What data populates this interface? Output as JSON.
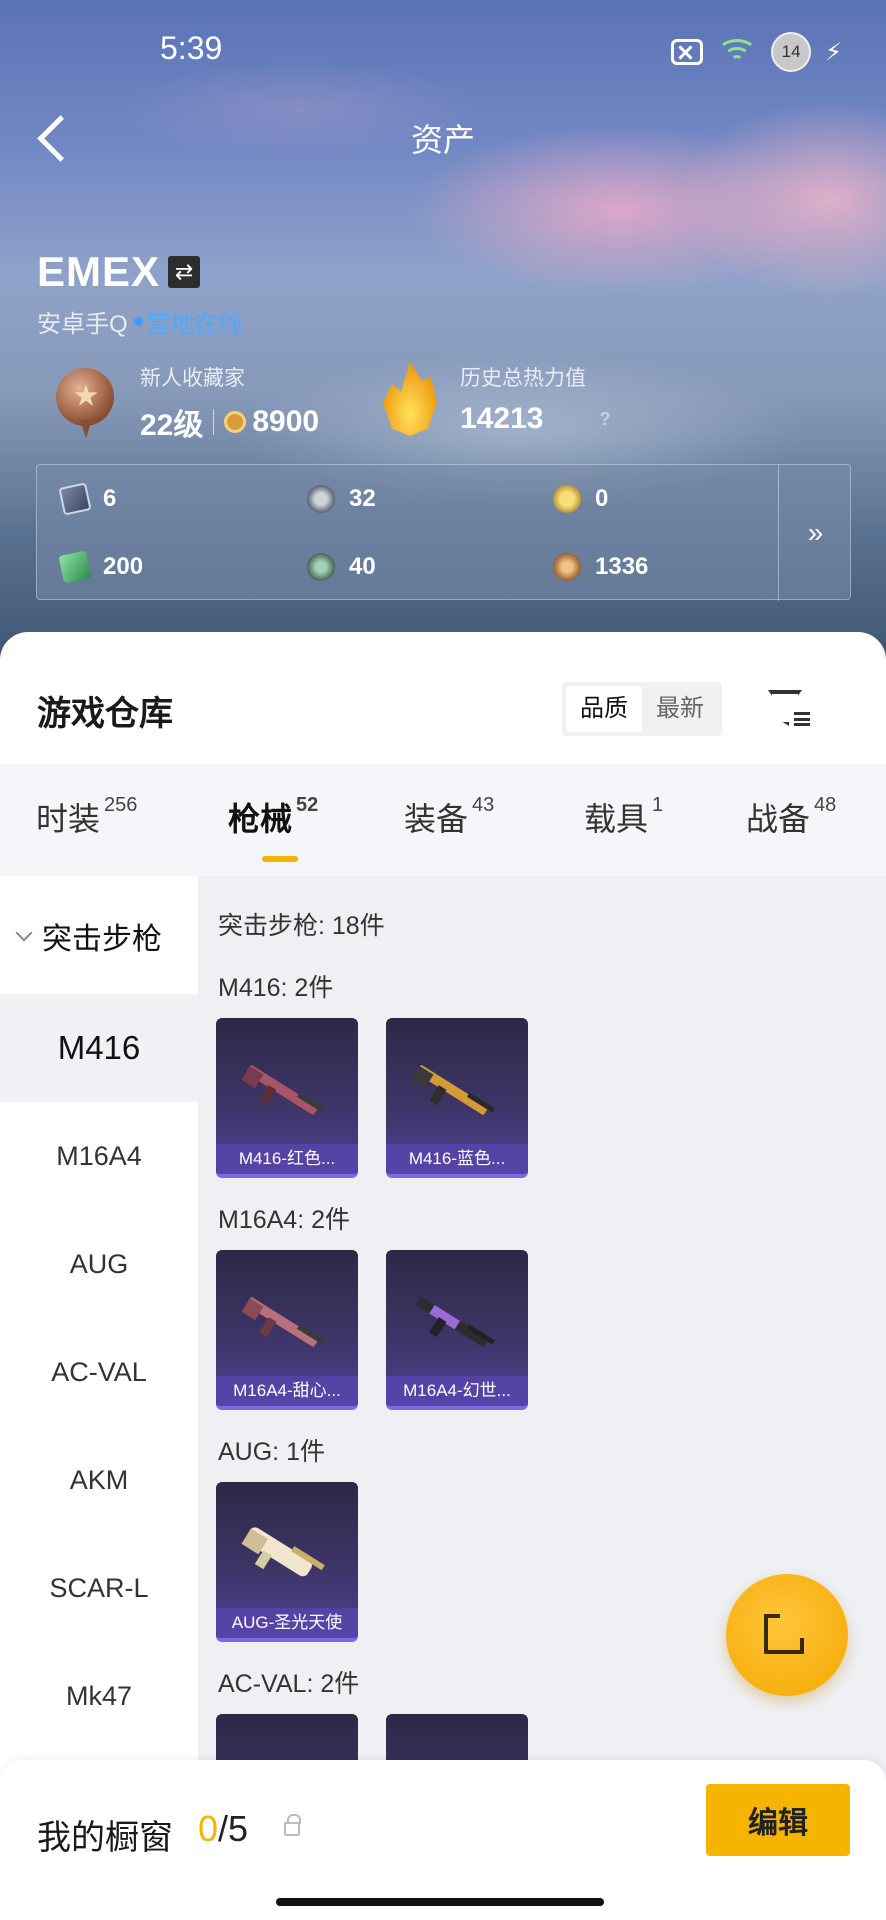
{
  "status_bar": {
    "time": "5:39",
    "battery_level": "14",
    "network": "6"
  },
  "header": {
    "title": "资产",
    "back": "back"
  },
  "profile": {
    "username": "EMEX",
    "platform": "安卓手Q",
    "online_status": "营地在线"
  },
  "level": {
    "title": "新人收藏家",
    "level": "22级",
    "coins": "8900"
  },
  "heat": {
    "title": "历史总热力值",
    "value": "14213",
    "help": "?"
  },
  "stats": [
    {
      "icon": "card-icon",
      "value": "6"
    },
    {
      "icon": "silver-coin-icon",
      "value": "32"
    },
    {
      "icon": "gold-coin-icon",
      "value": "0"
    },
    {
      "icon": "green-card-icon",
      "value": "200"
    },
    {
      "icon": "dark-coin-icon",
      "value": "40"
    },
    {
      "icon": "bronze-coin-icon",
      "value": "1336"
    }
  ],
  "stats_more": "»",
  "warehouse": {
    "title": "游戏仓库",
    "sort": [
      "品质",
      "最新"
    ],
    "tabs": [
      {
        "label": "时装",
        "count": "256"
      },
      {
        "label": "枪械",
        "count": "52"
      },
      {
        "label": "装备",
        "count": "43"
      },
      {
        "label": "载具",
        "count": "1"
      },
      {
        "label": "战备",
        "count": "48"
      }
    ],
    "side_head": "突击步枪",
    "side_items": [
      "M416",
      "M16A4",
      "AUG",
      "AC-VAL",
      "AKM",
      "SCAR-L",
      "Mk47"
    ],
    "category_summary": "突击步枪: 18件",
    "groups": [
      {
        "title": "M416: 2件",
        "items": [
          "M416-红色...",
          "M416-蓝色..."
        ]
      },
      {
        "title": "M16A4: 2件",
        "items": [
          "M16A4-甜心...",
          "M16A4-幻世..."
        ]
      },
      {
        "title": "AUG: 1件",
        "items": [
          "AUG-圣光天使"
        ]
      },
      {
        "title": "AC-VAL: 2件",
        "items": [
          "",
          ""
        ]
      }
    ]
  },
  "showcase": {
    "label": "我的橱窗",
    "current": "0",
    "total": "/5",
    "edit": "编辑"
  },
  "colors": {
    "accent": "#f5b400",
    "online": "#4da8ff",
    "card_bg": "#3d3566"
  }
}
